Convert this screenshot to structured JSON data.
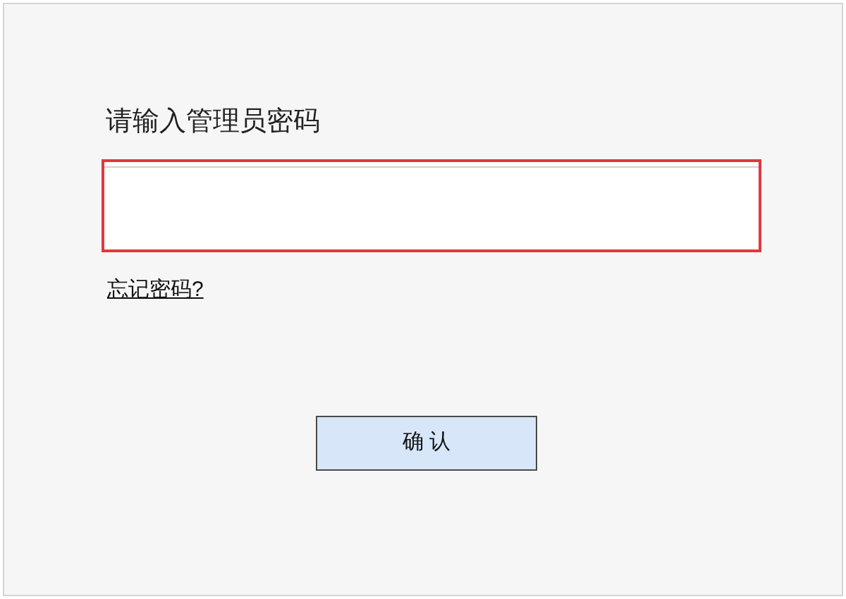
{
  "title": "请输入管理员密码",
  "forgot_link": "忘记密码?",
  "confirm_button": "确 认"
}
